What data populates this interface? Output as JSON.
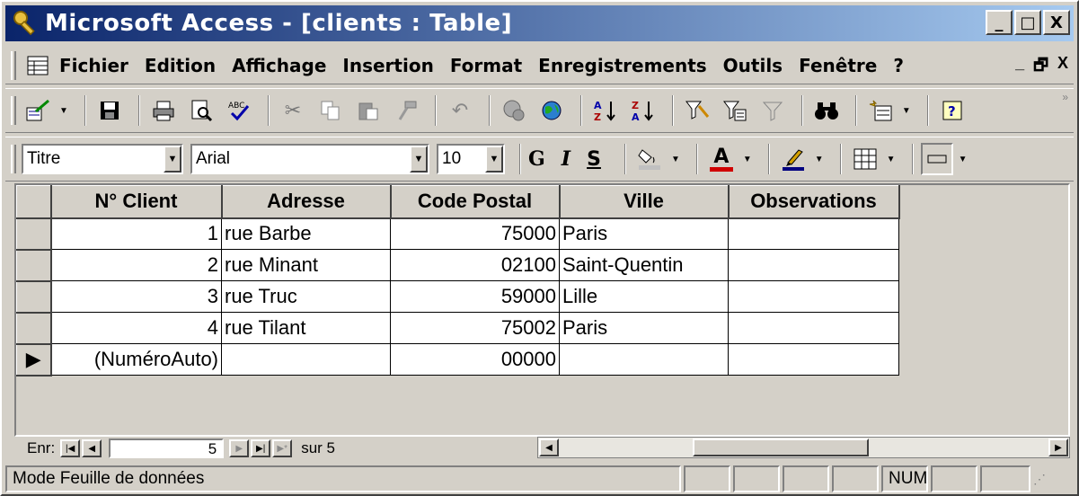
{
  "window": {
    "title": "Microsoft Access - [clients : Table]",
    "min_symbol": "_",
    "max_symbol": "□",
    "close_symbol": "X"
  },
  "menu": {
    "items": [
      "Fichier",
      "Edition",
      "Affichage",
      "Insertion",
      "Format",
      "Enregistrements",
      "Outils",
      "Fenêtre",
      "?"
    ],
    "mdi_min": "_",
    "mdi_restore": "🗗",
    "mdi_close": "X"
  },
  "format_toolbar": {
    "object": "Titre",
    "font": "Arial",
    "size": "10",
    "bold": "G",
    "italic": "I",
    "underline": "S",
    "font_color_letter": "A"
  },
  "table": {
    "columns": [
      "N° Client",
      "Adresse",
      "Code Postal",
      "Ville",
      "Observations"
    ],
    "rows": [
      {
        "selector": "",
        "client": "1",
        "adresse": "rue Barbe",
        "cp": "75000",
        "ville": "Paris",
        "obs": ""
      },
      {
        "selector": "",
        "client": "2",
        "adresse": "rue Minant",
        "cp": "02100",
        "ville": "Saint-Quentin",
        "obs": ""
      },
      {
        "selector": "",
        "client": "3",
        "adresse": "rue Truc",
        "cp": "59000",
        "ville": "Lille",
        "obs": ""
      },
      {
        "selector": "",
        "client": "4",
        "adresse": "rue Tilant",
        "cp": "75002",
        "ville": "Paris",
        "obs": ""
      },
      {
        "selector": "▶",
        "client": "(NuméroAuto)",
        "adresse": "",
        "cp": "00000",
        "ville": "",
        "obs": ""
      }
    ]
  },
  "navigation": {
    "label": "Enr:",
    "current": "5",
    "total_label": "sur 5"
  },
  "status": {
    "mode": "Mode Feuille de données",
    "num": "NUM"
  },
  "colors": {
    "title_start": "#0a246a",
    "title_end": "#a6caf0",
    "face": "#d4d0c8"
  }
}
